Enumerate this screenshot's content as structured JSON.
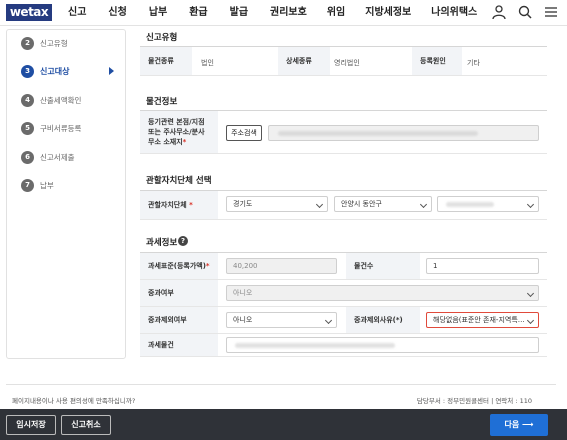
{
  "header": {
    "logo": "wetax",
    "menu": [
      "신고",
      "신청",
      "납부",
      "환급",
      "발급",
      "권리보호",
      "위임",
      "지방세정보",
      "나의위택스"
    ],
    "icons": [
      "user-icon",
      "search-icon",
      "menu-icon"
    ]
  },
  "sidebar": {
    "steps": [
      {
        "num": "2",
        "label": "신고유형"
      },
      {
        "num": "3",
        "label": "신고대상"
      },
      {
        "num": "4",
        "label": "산출세액확인"
      },
      {
        "num": "5",
        "label": "구비서류등록"
      },
      {
        "num": "6",
        "label": "신고서제출"
      },
      {
        "num": "7",
        "label": "납부"
      }
    ],
    "active_step": "3"
  },
  "report_type": {
    "title": "신고유형",
    "fields": [
      {
        "label": "물건종류",
        "value": "법인"
      },
      {
        "label": "상세종류",
        "value": "영리법인"
      },
      {
        "label": "등록원인",
        "value": "기타"
      }
    ]
  },
  "property_info": {
    "title": "물건정보",
    "address_label_1": "등기관련 본점/지점",
    "address_label_2": "또는 주사무소/분사",
    "address_label_3": "무소 소재지",
    "address_button": "주소검색"
  },
  "jurisdiction": {
    "title": "관할자치단체 선택",
    "label": "관할자치단체",
    "province": "경기도",
    "city": "안양시 동안구"
  },
  "tax_info": {
    "title": "과세정보",
    "tax_base_label": "과세표준(등록가액)",
    "tax_base_value": "40,200",
    "count_label": "물건수",
    "count_value": "1",
    "heavy_label": "중과여부",
    "heavy_value": "아니오",
    "heavy_exclude_label": "중과제외여부",
    "heavy_exclude_value": "아니오",
    "heavy_exclude_reason_label": "중과제외사유(*)",
    "heavy_exclude_reason_value": "해당없음(표준안 존재-지역특…",
    "tax_item_label": "과세물건"
  },
  "footer": {
    "feedback": "페이지내용이나 사용 편의성에 만족하십니까?",
    "dept": "담당부서 : 정부민원콜센터 | 연락처 : 110"
  },
  "bottom_bar": {
    "temp_save": "임시저장",
    "cancel": "신고취소",
    "next": "다음 ⟶"
  },
  "colors": {
    "primary": "#1f4ea3",
    "next_button": "#1f6fd6",
    "bottom_bar": "#2f3238",
    "error": "#e04a3b"
  }
}
